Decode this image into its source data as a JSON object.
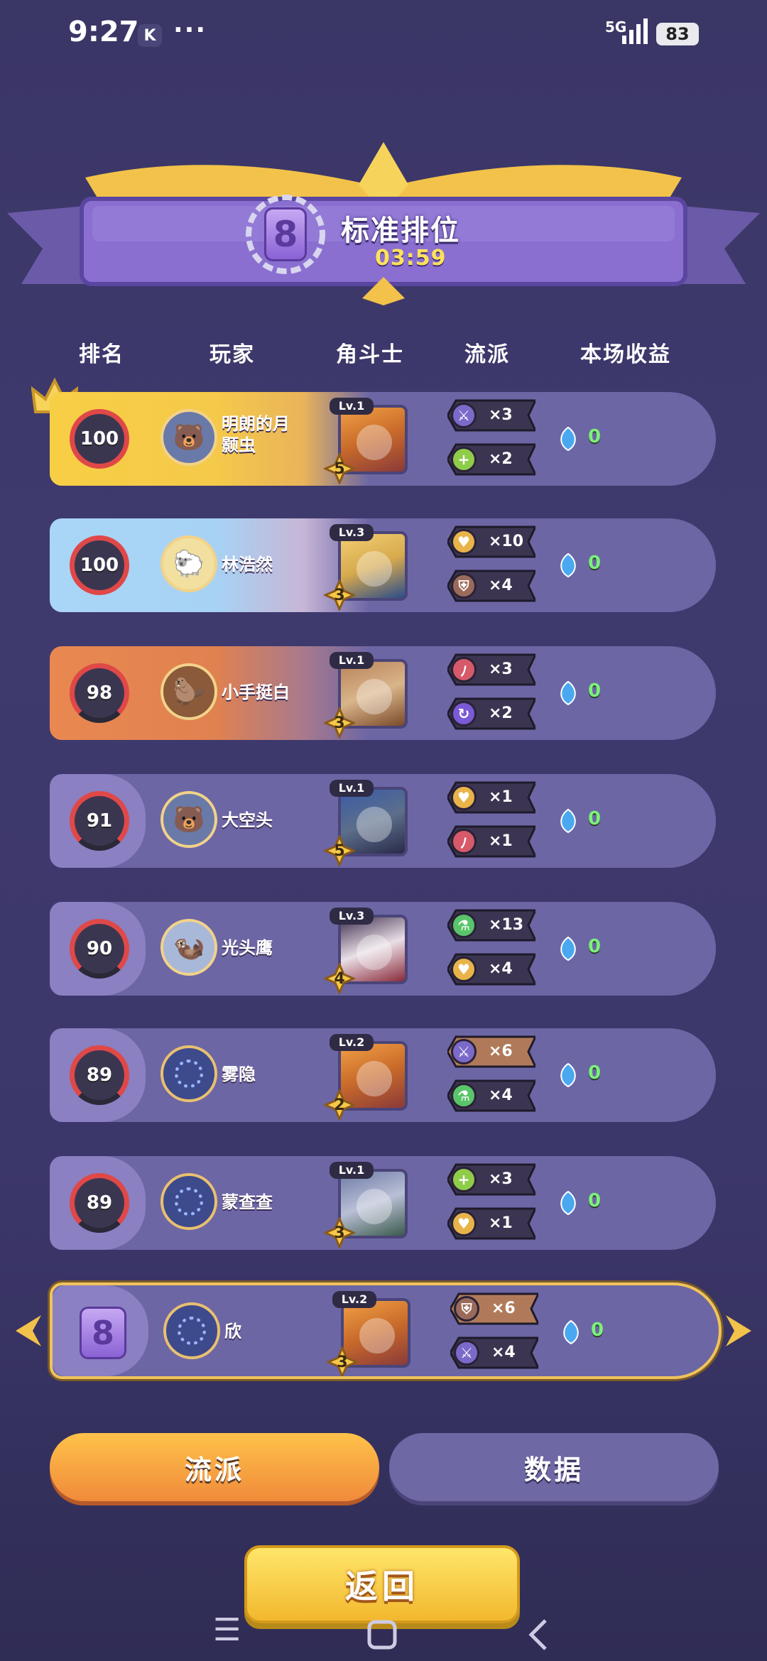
{
  "status_bar": {
    "time": "9:27",
    "app_badge": "K",
    "more": "···",
    "network": "5G",
    "battery": "83"
  },
  "header": {
    "my_rank": "8",
    "title": "标准排位",
    "timer": "03:59"
  },
  "columns": {
    "rank": "排名",
    "player": "玩家",
    "gladiator": "角斗士",
    "style": "流派",
    "earnings": "本场收益"
  },
  "rows": [
    {
      "score": "100",
      "score_fraction": 1.0,
      "name": "明朗的月\n颢虫",
      "level": "Lv.1",
      "stars": "5",
      "tags": [
        {
          "icon": "sword-icon",
          "color": "#7b6ac9",
          "count": "×3"
        },
        {
          "icon": "plus-icon",
          "color": "#8fcc4a",
          "count": "×2"
        }
      ],
      "earnings": "0"
    },
    {
      "score": "100",
      "score_fraction": 1.0,
      "name": "林浩然",
      "level": "Lv.3",
      "stars": "3",
      "tags": [
        {
          "icon": "heart-icon",
          "color": "#e8b44a",
          "count": "×10"
        },
        {
          "icon": "shield-icon",
          "color": "#9a6a5a",
          "count": "×4"
        }
      ],
      "earnings": "0"
    },
    {
      "score": "98",
      "score_fraction": 0.98,
      "name": "小手挺白",
      "level": "Lv.1",
      "stars": "3",
      "tags": [
        {
          "icon": "claw-icon",
          "color": "#d65a6a",
          "count": "×3"
        },
        {
          "icon": "cycle-icon",
          "color": "#7a5ad6",
          "count": "×2"
        }
      ],
      "earnings": "0"
    },
    {
      "score": "91",
      "score_fraction": 0.91,
      "name": "大空头",
      "level": "Lv.1",
      "stars": "5",
      "tags": [
        {
          "icon": "heart-icon",
          "color": "#e8b44a",
          "count": "×1"
        },
        {
          "icon": "claw-icon",
          "color": "#d65a6a",
          "count": "×1"
        }
      ],
      "earnings": "0"
    },
    {
      "score": "90",
      "score_fraction": 0.9,
      "name": "光头鹰",
      "level": "Lv.3",
      "stars": "4",
      "tags": [
        {
          "icon": "potion-icon",
          "color": "#5ac46a",
          "count": "×13"
        },
        {
          "icon": "heart-icon",
          "color": "#e8b44a",
          "count": "×4"
        }
      ],
      "earnings": "0"
    },
    {
      "score": "89",
      "score_fraction": 0.89,
      "name": "雾隐",
      "level": "Lv.2",
      "stars": "2",
      "tags": [
        {
          "icon": "sword-icon",
          "color": "#7b6ac9",
          "count": "×6"
        },
        {
          "icon": "potion-icon",
          "color": "#5ac46a",
          "count": "×4"
        }
      ],
      "earnings": "0"
    },
    {
      "score": "89",
      "score_fraction": 0.89,
      "name": "蒙查查",
      "level": "Lv.1",
      "stars": "3",
      "tags": [
        {
          "icon": "plus-icon",
          "color": "#8fcc4a",
          "count": "×3"
        },
        {
          "icon": "heart-icon",
          "color": "#e8b44a",
          "count": "×1"
        }
      ],
      "earnings": "0"
    },
    {
      "rank": "8",
      "name": "欣",
      "level": "Lv.2",
      "stars": "3",
      "tags": [
        {
          "icon": "shield-icon",
          "color": "#9a6a5a",
          "count": "×6"
        },
        {
          "icon": "sword-icon",
          "color": "#7b6ac9",
          "count": "×4"
        }
      ],
      "earnings": "0"
    }
  ],
  "buttons": {
    "style": "流派",
    "data": "数据",
    "back": "返回"
  },
  "colors": {
    "gold": "#f7cf45",
    "silver": "#a9d6f7",
    "bronze": "#e98850",
    "row": "#6c66a5",
    "earn": "#7cf07a"
  }
}
